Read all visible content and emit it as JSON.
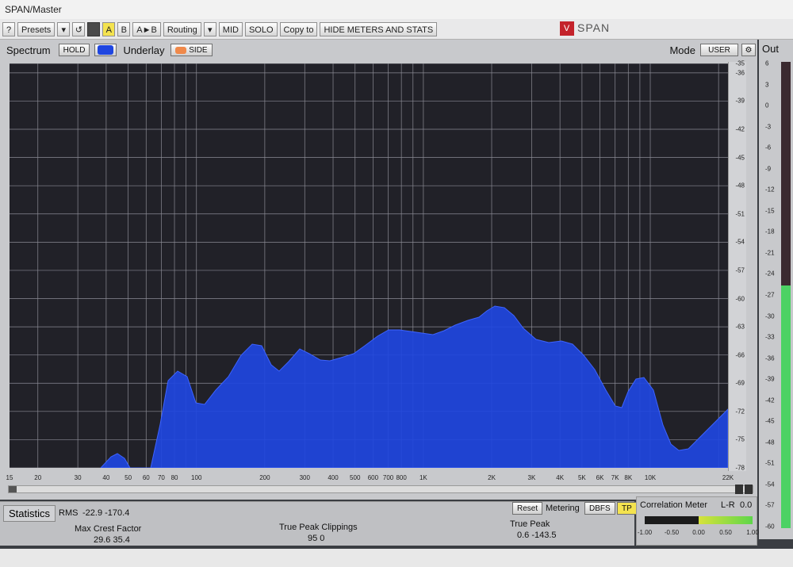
{
  "window": {
    "title": "SPAN/Master"
  },
  "toolbar": {
    "help": "?",
    "presets": "Presets",
    "a": "A",
    "b": "B",
    "ab": "A►B",
    "routing": "Routing",
    "mid": "MID",
    "solo": "SOLO",
    "copy_to": "Copy to",
    "hide_meters": "HIDE METERS AND STATS"
  },
  "brand": {
    "logo": "V",
    "name": "SPAN"
  },
  "spectrum": {
    "title": "Spectrum",
    "hold": "HOLD",
    "underlay": "Underlay",
    "side": "SIDE",
    "mode_label": "Mode",
    "mode_value": "USER",
    "fill_color": "#1f46e0"
  },
  "db_ticks": [
    "-35",
    "-36",
    "-39",
    "-42",
    "-45",
    "-48",
    "-51",
    "-54",
    "-57",
    "-60",
    "-63",
    "-66",
    "-69",
    "-72",
    "-75",
    "-78"
  ],
  "freq_ticks": [
    "15",
    "20",
    "30",
    "40",
    "50",
    "60",
    "70",
    "80",
    "100",
    "200",
    "300",
    "400",
    "500",
    "600",
    "700",
    "800",
    "1K",
    "2K",
    "3K",
    "4K",
    "5K",
    "6K",
    "7K",
    "8K",
    "10K",
    "22K"
  ],
  "out": {
    "title": "Out",
    "ticks": [
      "6",
      "3",
      "0",
      "-3",
      "-6",
      "-9",
      "-12",
      "-15",
      "-18",
      "-21",
      "-24",
      "-27",
      "-30",
      "-33",
      "-36",
      "-39",
      "-42",
      "-45",
      "-48",
      "-51",
      "-54",
      "-57",
      "-60"
    ],
    "level_fraction": 0.52
  },
  "stats": {
    "title": "Statistics",
    "rms_label": "RMS",
    "rms_values": "-22.9  -170.4",
    "crest_label": "Max Crest Factor",
    "crest_values": "29.6   35.4",
    "clip_label": "True Peak Clippings",
    "clip_values": "95     0",
    "tp_label": "True Peak",
    "tp_values": "0.6   -143.5",
    "reset": "Reset",
    "metering": "Metering",
    "dbfs": "DBFS",
    "tp": "TP"
  },
  "correlation": {
    "title": "Correlation Meter",
    "lr": "L-R",
    "value": "0.0",
    "ticks": [
      "-1.00",
      "-0.50",
      "0.00",
      "0.50",
      "1.00"
    ]
  }
}
